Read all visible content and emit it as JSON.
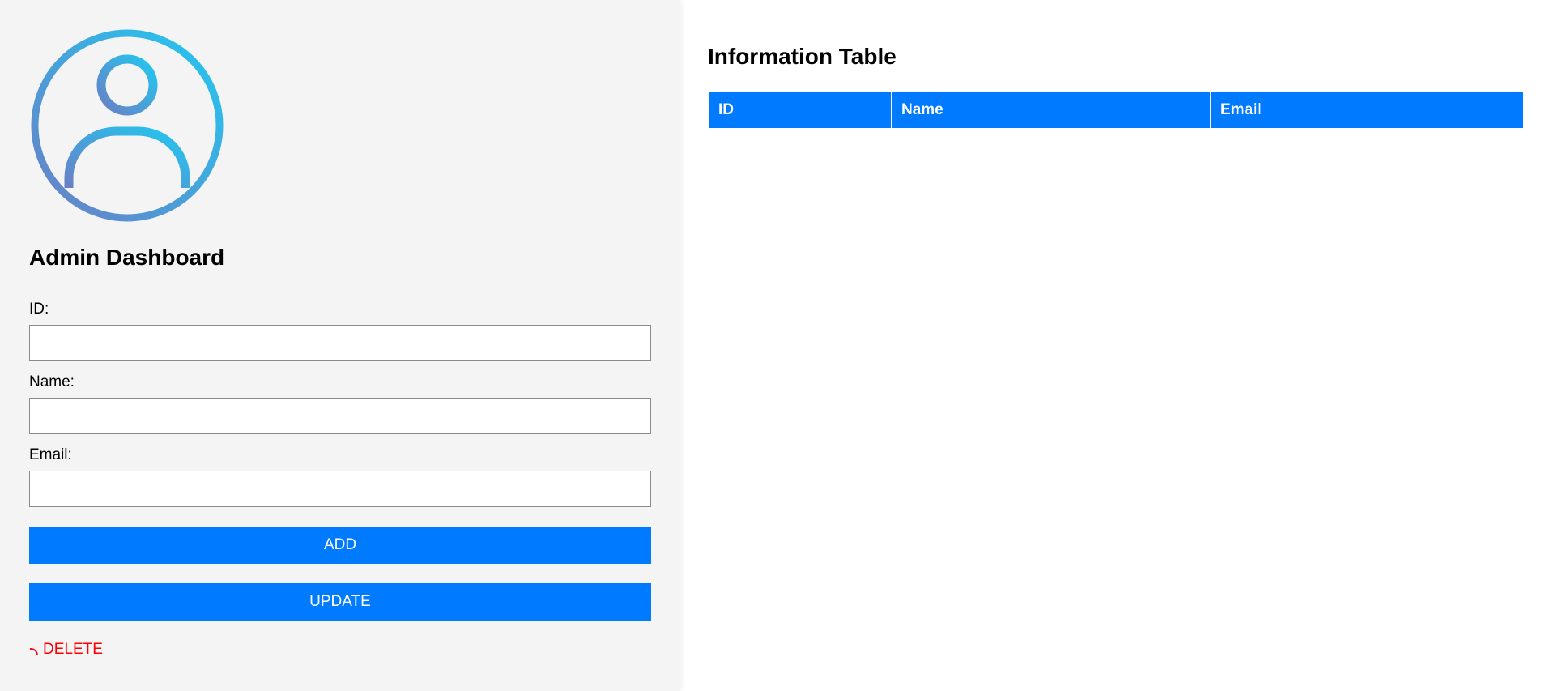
{
  "sidebar": {
    "avatar_icon": "user-circle-icon",
    "title": "Admin Dashboard",
    "form": {
      "id_label": "ID:",
      "id_value": "",
      "name_label": "Name:",
      "name_value": "",
      "email_label": "Email:",
      "email_value": ""
    },
    "buttons": {
      "add_label": "ADD",
      "update_label": "UPDATE",
      "delete_label": "DELETE",
      "delete_icon": "spinner-arc-icon"
    }
  },
  "main": {
    "title": "Information Table",
    "table": {
      "columns": [
        "ID",
        "Name",
        "Email"
      ],
      "rows": []
    }
  },
  "colors": {
    "primary": "#007bff",
    "sidebar_bg": "#f4f4f4",
    "danger": "#ff0000",
    "avatar_gradient_start": "#22c8f0",
    "avatar_gradient_end": "#6a7fc6"
  }
}
